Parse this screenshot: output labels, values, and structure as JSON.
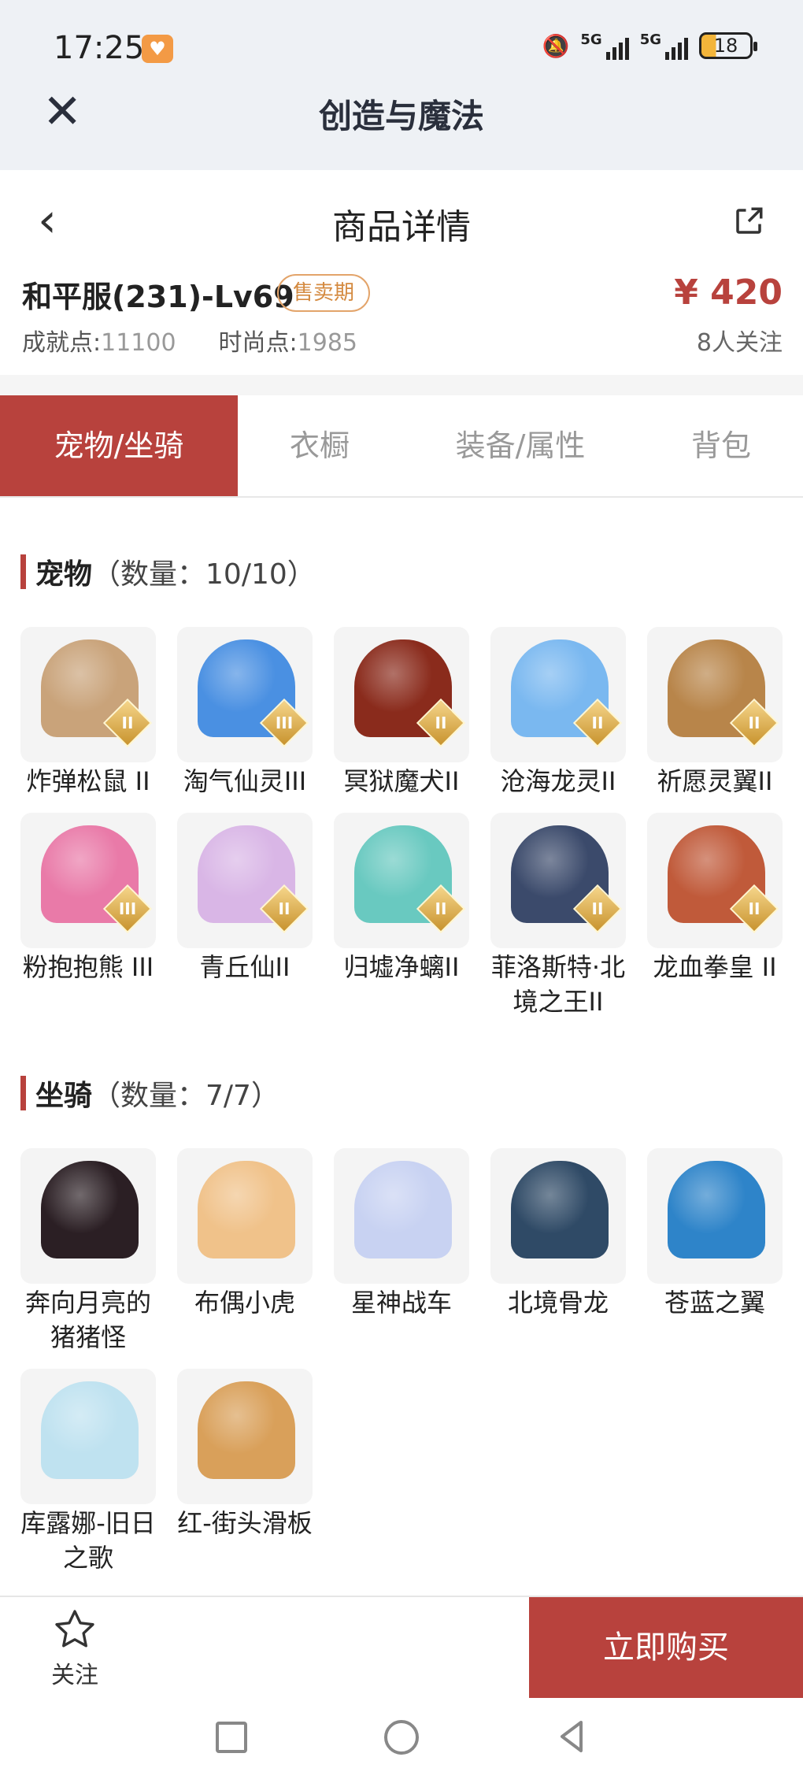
{
  "status_bar": {
    "time": "17:25",
    "signal1_label": "5G",
    "signal2_label": "5G",
    "battery": "18",
    "icons": [
      "heart-icon",
      "mute-bell-icon",
      "signal-icon",
      "battery-icon"
    ]
  },
  "app_header": {
    "title": "创造与魔法",
    "close_icon": "close-icon"
  },
  "page": {
    "title": "商品详情",
    "back_icon": "back-arrow-icon",
    "share_icon": "share-icon"
  },
  "product": {
    "name": "和平服(231)-Lv69",
    "tag": "售卖期",
    "price": "¥ 420",
    "followers": "8人关注",
    "achievement_label": "成就点:",
    "achievement_value": "11100",
    "fashion_label": "时尚点:",
    "fashion_value": "1985"
  },
  "tabs": [
    "宠物/坐骑",
    "衣橱",
    "装备/属性",
    "背包"
  ],
  "pets": {
    "title": "宠物",
    "count": "（数量：10/10）",
    "items": [
      {
        "name": "炸弹松鼠 II",
        "tier": "II",
        "color": "#c9a37a"
      },
      {
        "name": "淘气仙灵III",
        "tier": "III",
        "color": "#4a90e2"
      },
      {
        "name": "冥狱魔犬II",
        "tier": "II",
        "color": "#8a2b1c"
      },
      {
        "name": "沧海龙灵II",
        "tier": "II",
        "color": "#7ab8f0"
      },
      {
        "name": "祈愿灵翼II",
        "tier": "II",
        "color": "#b8854a"
      },
      {
        "name": "粉抱抱熊 III",
        "tier": "III",
        "color": "#e97aa8"
      },
      {
        "name": "青丘仙II",
        "tier": "II",
        "color": "#d9b6e6"
      },
      {
        "name": "归墟净螭II",
        "tier": "II",
        "color": "#69c9c0"
      },
      {
        "name": "菲洛斯特·北境之王II",
        "tier": "II",
        "color": "#3b4a6b"
      },
      {
        "name": "龙血拳皇 II",
        "tier": "II",
        "color": "#c05a3a"
      }
    ]
  },
  "mounts": {
    "title": "坐骑",
    "count": "（数量：7/7）",
    "items": [
      {
        "name": "奔向月亮的猪猪怪",
        "color": "#2b1f24"
      },
      {
        "name": "布偶小虎",
        "color": "#f0c28a"
      },
      {
        "name": "星神战车",
        "color": "#c8d2f2"
      },
      {
        "name": "北境骨龙",
        "color": "#2f4a66"
      },
      {
        "name": "苍蓝之翼",
        "color": "#2e84c9"
      },
      {
        "name": "库露娜-旧日之歌",
        "color": "#bfe2f0"
      },
      {
        "name": "红-街头滑板",
        "color": "#d9a05a"
      }
    ]
  },
  "bottom": {
    "follow_label": "关注",
    "buy_label": "立即购买"
  },
  "colors": {
    "accent": "#b8423d",
    "tag": "#d48a40"
  }
}
